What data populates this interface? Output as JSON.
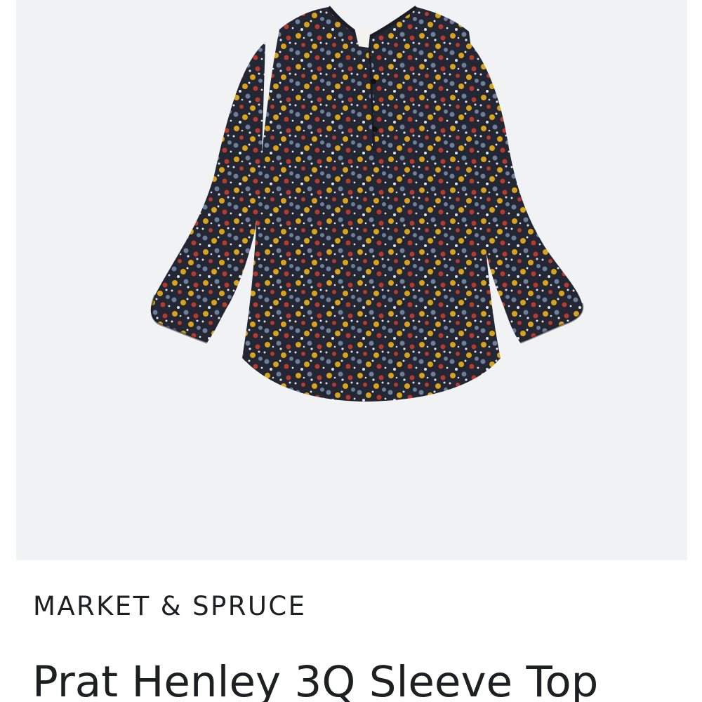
{
  "product": {
    "brand": "MARKET & SPRUCE",
    "title": "Prat Henley 3Q Sleeve Top",
    "image_subject": "floral-print-henley-top"
  },
  "colors": {
    "image_background": "#f1f2f4",
    "page_background": "#ffffff",
    "text": "#1e1f22",
    "fabric_base": "#232633",
    "print_yellow": "#d9a21c",
    "print_red": "#b63a2e",
    "print_blue": "#6d7f9c",
    "print_white": "#dfe2e6"
  }
}
